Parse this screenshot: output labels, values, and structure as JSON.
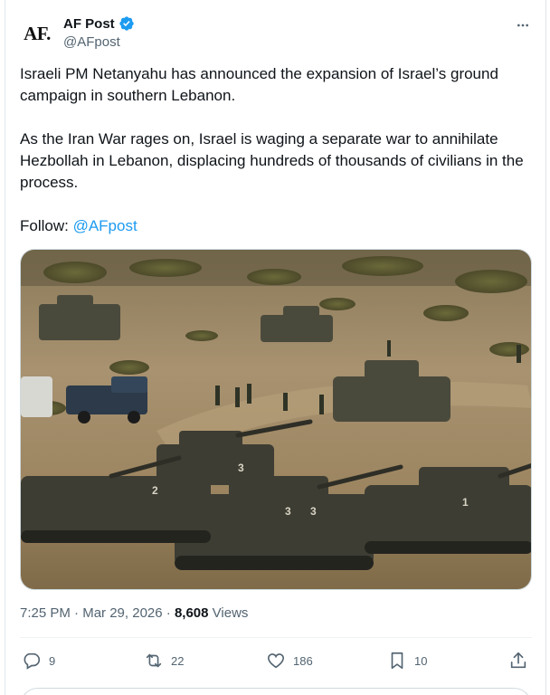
{
  "author": {
    "avatar_text": "AF.",
    "name": "AF Post",
    "handle": "@AFpost"
  },
  "tweet": {
    "paragraph1": "Israeli PM Netanyahu has announced the expansion of Israel’s ground campaign in southern Lebanon.",
    "paragraph2": "As the Iran War rages on, Israel is waging a separate war to annihilate Hezbollah in Lebanon, displacing hundreds of thousands of civilians in the process.",
    "follow_label": "Follow: ",
    "follow_mention": "@AFpost"
  },
  "meta": {
    "time": "7:25 PM",
    "separator": " · ",
    "date": "Mar 29, 2026",
    "views_count": "8,608",
    "views_label": " Views"
  },
  "actions": {
    "replies": "9",
    "reposts": "22",
    "likes": "186",
    "bookmarks": "10"
  },
  "colors": {
    "accent": "#1d9bf0",
    "text": "#0f1419",
    "muted": "#536471"
  },
  "icons": [
    "verified-badge-icon",
    "more-icon",
    "reply-icon",
    "repost-icon",
    "like-icon",
    "bookmark-icon",
    "share-icon"
  ]
}
